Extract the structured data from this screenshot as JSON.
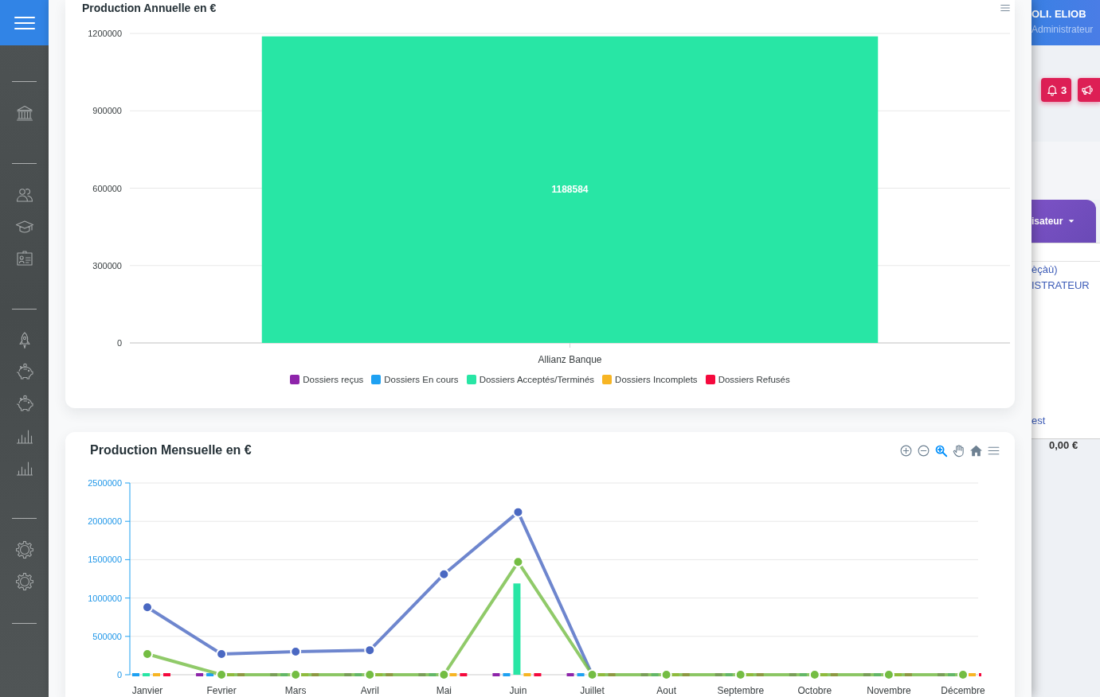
{
  "annual_chart": {
    "title": "Production Annuelle en €",
    "chart_data": {
      "type": "bar",
      "categories": [
        "Allianz Banque"
      ],
      "series": [
        {
          "name": "Dossiers reçus",
          "color": "#8e24aa",
          "values": [
            0
          ]
        },
        {
          "name": "Dossiers En cours",
          "color": "#1ea1f2",
          "values": [
            0
          ]
        },
        {
          "name": "Dossiers Acceptés/Terminés",
          "color": "#28e6a5",
          "values": [
            1188584
          ]
        },
        {
          "name": "Dossiers Incomplets",
          "color": "#f7b524",
          "values": [
            0
          ]
        },
        {
          "name": "Dossiers Refusés",
          "color": "#f5093d",
          "values": [
            0
          ]
        }
      ],
      "ylim": [
        0,
        1200000
      ],
      "yticks": [
        0,
        300000,
        600000,
        900000,
        1200000
      ],
      "grid": true,
      "value_labels": [
        [
          null
        ],
        [
          null
        ],
        [
          "1188584"
        ],
        [
          null
        ],
        [
          null
        ]
      ]
    }
  },
  "monthly_chart": {
    "title": "Production Mensuelle en €",
    "toolbar": [
      {
        "kind": "zoom-in",
        "selected": false
      },
      {
        "kind": "zoom-out",
        "selected": false
      },
      {
        "kind": "zoom",
        "selected": true
      },
      {
        "kind": "pan",
        "selected": false
      },
      {
        "kind": "reset",
        "selected": false
      },
      {
        "kind": "menu",
        "selected": false
      }
    ],
    "chart_data": {
      "type": "bar",
      "categories": [
        "Janvier",
        "Fevrier",
        "Mars",
        "Avril",
        "Mai",
        "Juin",
        "Juillet",
        "Aout",
        "Septembre",
        "Octobre",
        "Novembre",
        "Décembre"
      ],
      "series": [
        {
          "color": "#8e24aa",
          "values": [
            null,
            0,
            0,
            0,
            0,
            0,
            0,
            0,
            0,
            0,
            0,
            0
          ]
        },
        {
          "color": "#1ea1f2",
          "values": [
            0,
            0,
            0,
            0,
            0,
            0,
            0,
            0,
            0,
            0,
            0,
            0
          ]
        },
        {
          "color": "#28e6a5",
          "values": [
            0,
            null,
            null,
            null,
            null,
            1190000,
            null,
            null,
            null,
            null,
            null,
            null
          ]
        },
        {
          "color": "#f7b524",
          "values": [
            0,
            0,
            0,
            0,
            0,
            0,
            0,
            0,
            0,
            0,
            0,
            0
          ]
        },
        {
          "color": "#f5093d",
          "values": [
            0,
            0,
            0,
            0,
            0,
            0,
            0,
            0,
            0,
            0,
            0,
            0
          ]
        },
        {
          "type": "line",
          "color": "#4a68c2",
          "marker": true,
          "values": [
            880000,
            270000,
            300000,
            320000,
            1310000,
            2120000,
            0,
            null,
            null,
            null,
            null,
            null
          ]
        },
        {
          "type": "line",
          "color": "#74bd43",
          "marker": true,
          "values": [
            270000,
            0,
            0,
            0,
            0,
            1470000,
            0,
            0,
            0,
            0,
            0,
            0
          ]
        }
      ],
      "ylim": [
        0,
        2500000
      ],
      "yticks": [
        0,
        500000,
        1000000,
        1500000,
        2000000,
        2500000
      ],
      "grid": true
    }
  },
  "background_page": {
    "user_name": "OLI. ELIOB",
    "user_role": "Administrateur",
    "notification_count": "3",
    "tab_label": "isateur",
    "lines": [
      "èçàù)",
      "ISTRATEUR"
    ],
    "link_text": "est",
    "amount": "0,00 €"
  }
}
